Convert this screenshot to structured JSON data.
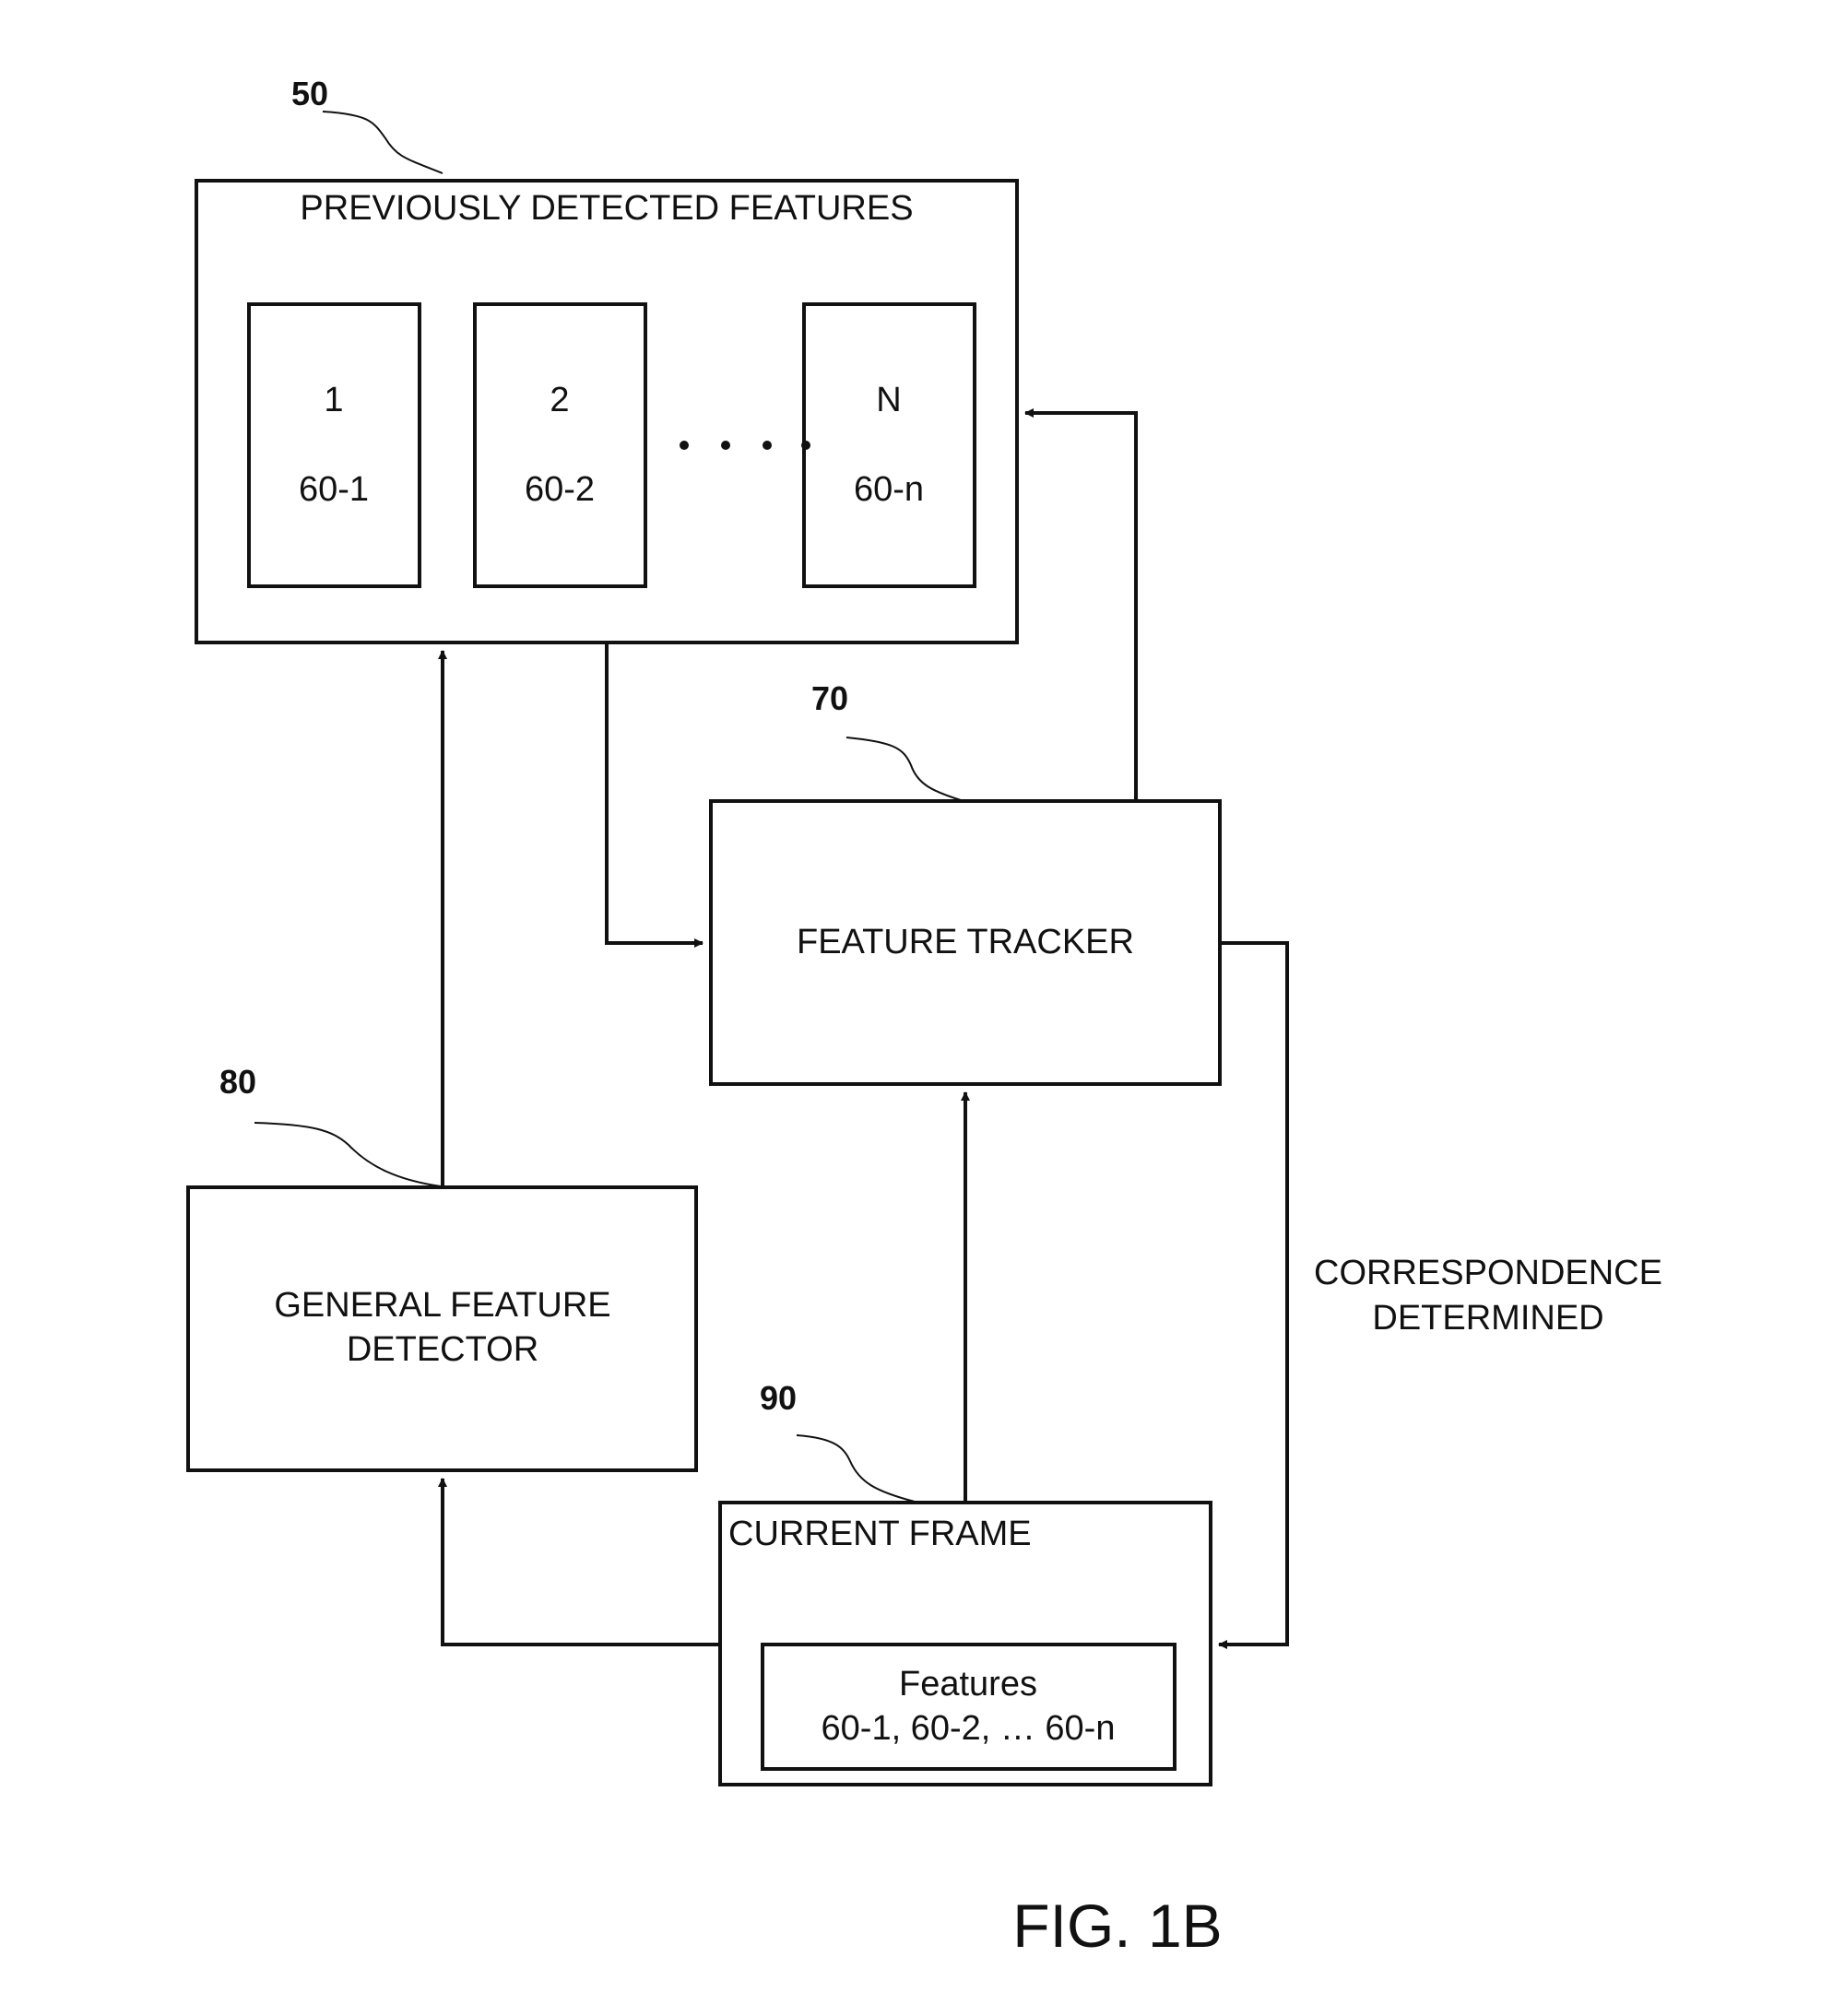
{
  "figure_label": "FIG. 1B",
  "blocks": {
    "previously_detected": {
      "ref": "50",
      "title": "PREVIOUSLY DETECTED FEATURES",
      "features": [
        {
          "index": "1",
          "id": "60-1"
        },
        {
          "index": "2",
          "id": "60-2"
        },
        {
          "index": "N",
          "id": "60-n"
        }
      ]
    },
    "feature_tracker": {
      "ref": "70",
      "title": "FEATURE TRACKER"
    },
    "general_detector": {
      "ref": "80",
      "title_line1": "GENERAL FEATURE",
      "title_line2": "DETECTOR"
    },
    "current_frame": {
      "ref": "90",
      "title": "CURRENT FRAME",
      "features_title": "Features",
      "features_list": "60-1, 60-2, … 60-n"
    }
  },
  "edges": {
    "correspondence_line1": "CORRESPONDENCE",
    "correspondence_line2": "DETERMINED"
  }
}
